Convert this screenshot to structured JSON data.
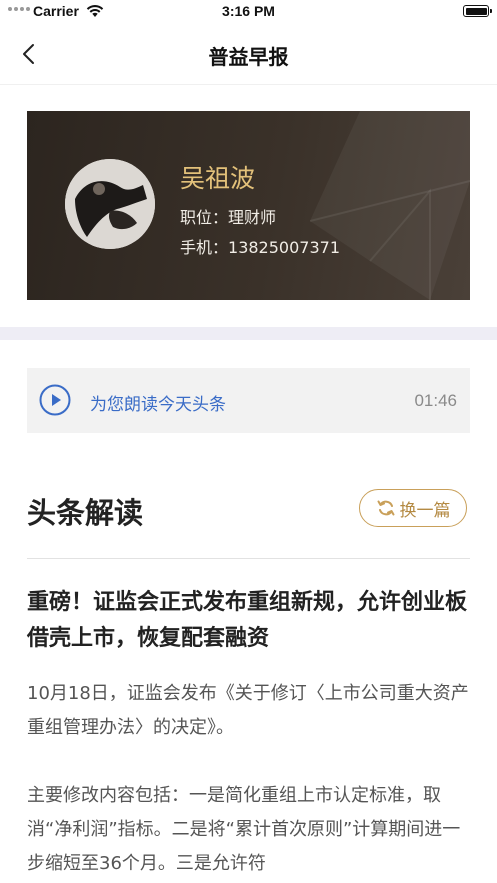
{
  "status_bar": {
    "carrier": "Carrier",
    "time": "3:16 PM"
  },
  "nav": {
    "title": "普益早报",
    "back_icon": "chevron-left-icon"
  },
  "profile": {
    "name": "吴祖波",
    "position_label": "职位：",
    "position": "理财师",
    "phone_label": "手机：",
    "phone": "13825007371"
  },
  "audio": {
    "label": "为您朗读今天头条",
    "duration": "01:46"
  },
  "section": {
    "title": "头条解读",
    "swap_label": "换一篇"
  },
  "article": {
    "headline": "重磅！证监会正式发布重组新规，允许创业板借壳上市，恢复配套融资",
    "paragraph1": "10月18日，证监会发布《关于修订〈上市公司重大资产重组管理办法〉的决定》。",
    "paragraph2": "主要修改内容包括：一是简化重组上市认定标准，取消“净利润”指标。二是将“累计首次原则”计算期间进一步缩短至36个月。三是允许符"
  },
  "colors": {
    "accent_gold": "#e3c17a",
    "link_blue": "#3a6cc7",
    "button_gold": "#c9a05a"
  }
}
